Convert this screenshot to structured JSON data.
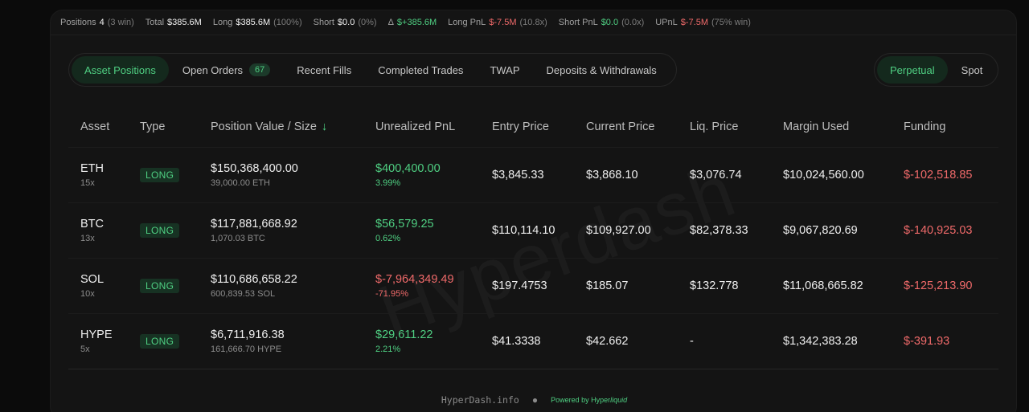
{
  "stats": [
    {
      "label": "Positions",
      "value": "4",
      "paren": "(3 win)"
    },
    {
      "label": "Total",
      "value": "$385.6M",
      "paren": ""
    },
    {
      "label": "Long",
      "value": "$385.6M",
      "paren": "(100%)"
    },
    {
      "label": "Short",
      "value": "$0.0",
      "paren": "(0%)"
    },
    {
      "label": "Δ",
      "value": "$+385.6M",
      "paren": ""
    },
    {
      "label": "Long PnL",
      "value": "$-7.5M",
      "paren": "(10.8x)"
    },
    {
      "label": "Short PnL",
      "value": "$0.0",
      "paren": "(0.0x)"
    },
    {
      "label": "UPnL",
      "value": "$-7.5M",
      "paren": "(75% win)"
    }
  ],
  "tabs": [
    {
      "label": "Asset Positions"
    },
    {
      "label": "Open Orders",
      "badge": "67"
    },
    {
      "label": "Recent Fills"
    },
    {
      "label": "Completed Trades"
    },
    {
      "label": "TWAP"
    },
    {
      "label": "Deposits & Withdrawals"
    }
  ],
  "market_tabs": [
    {
      "label": "Perpetual"
    },
    {
      "label": "Spot"
    }
  ],
  "columns": [
    "Asset",
    "Type",
    "Position Value / Size",
    "Unrealized PnL",
    "Entry Price",
    "Current Price",
    "Liq. Price",
    "Margin Used",
    "Funding"
  ],
  "sort_arrow": "↓",
  "rows": [
    {
      "asset": "ETH",
      "leverage": "15x",
      "type": "LONG",
      "value": "$150,368,400.00",
      "size": "39,000.00 ETH",
      "pnl": "$400,400.00",
      "pnl_pct": "3.99%",
      "entry": "$3,845.33",
      "current": "$3,868.10",
      "liq": "$3,076.74",
      "margin": "$10,024,560.00",
      "funding": "$-102,518.85"
    },
    {
      "asset": "BTC",
      "leverage": "13x",
      "type": "LONG",
      "value": "$117,881,668.92",
      "size": "1,070.03 BTC",
      "pnl": "$56,579.25",
      "pnl_pct": "0.62%",
      "entry": "$110,114.10",
      "current": "$109,927.00",
      "liq": "$82,378.33",
      "margin": "$9,067,820.69",
      "funding": "$-140,925.03"
    },
    {
      "asset": "SOL",
      "leverage": "10x",
      "type": "LONG",
      "value": "$110,686,658.22",
      "size": "600,839.53 SOL",
      "pnl": "$-7,964,349.49",
      "pnl_pct": "-71.95%",
      "entry": "$197.4753",
      "current": "$185.07",
      "liq": "$132.778",
      "margin": "$11,068,665.82",
      "funding": "$-125,213.90"
    },
    {
      "asset": "HYPE",
      "leverage": "5x",
      "type": "LONG",
      "value": "$6,711,916.38",
      "size": "161,666.70 HYPE",
      "pnl": "$29,611.22",
      "pnl_pct": "2.21%",
      "entry": "$41.3338",
      "current": "$42.662",
      "liq": "-",
      "margin": "$1,342,383.28",
      "funding": "$-391.93"
    }
  ],
  "footer": {
    "site": "HyperDash.info",
    "dot": "●",
    "powered_prefix": "Powered by Hyper",
    "powered_italic": "liquid"
  },
  "watermark": "Hyperdash",
  "colors": {
    "positive": "#4fcf82",
    "negative": "#f06a6a",
    "background": "#141414"
  }
}
